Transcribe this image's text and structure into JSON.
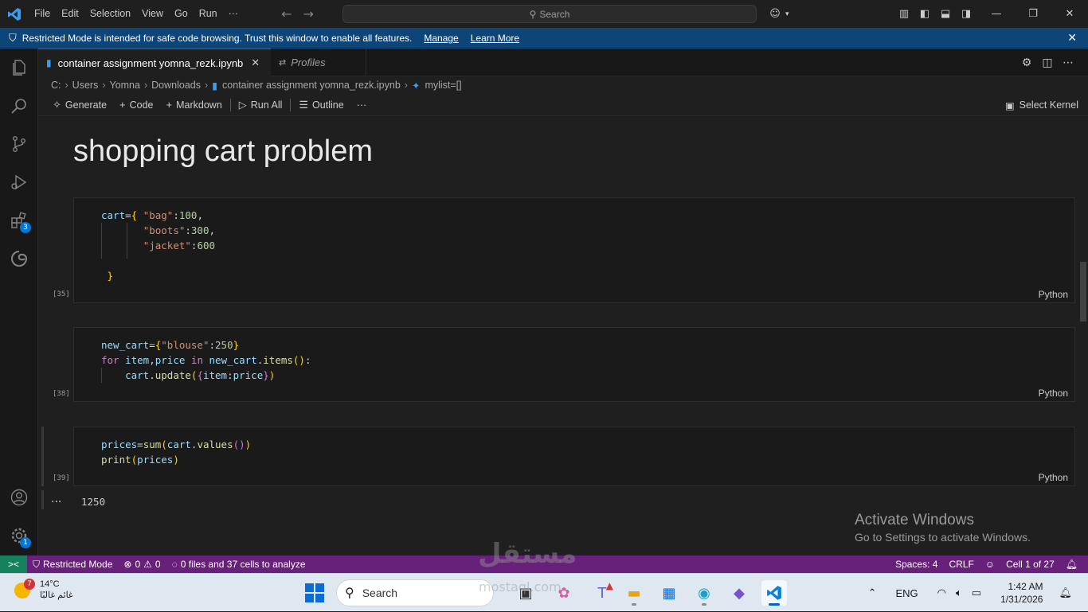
{
  "titlebar": {
    "menus": [
      "File",
      "Edit",
      "Selection",
      "View",
      "Go",
      "Run",
      "···"
    ],
    "search_placeholder": "Search"
  },
  "banner": {
    "message": "Restricted Mode is intended for safe code browsing. Trust this window to enable all features.",
    "manage": "Manage",
    "learn_more": "Learn More"
  },
  "activitybar": {
    "extensions_badge": "3",
    "settings_badge": "1"
  },
  "tabs": [
    {
      "label": "container assignment yomna_rezk.ipynb",
      "active": true
    },
    {
      "label": "Profiles",
      "active": false
    }
  ],
  "breadcrumb": [
    "C:",
    "Users",
    "Yomna",
    "Downloads",
    "container assignment yomna_rezk.ipynb",
    "mylist=[]"
  ],
  "nbtoolbar": {
    "generate": "Generate",
    "code": "Code",
    "markdown": "Markdown",
    "run_all": "Run All",
    "outline": "Outline",
    "more": "···",
    "select_kernel": "Select Kernel"
  },
  "notebook": {
    "heading": "shopping cart problem",
    "cells": [
      {
        "exec": "[35]",
        "lang": "Python"
      },
      {
        "exec": "[38]",
        "lang": "Python"
      },
      {
        "exec": "[39]",
        "lang": "Python"
      }
    ],
    "output": "1250",
    "output_dots": "···"
  },
  "activate": {
    "line1": "Activate Windows",
    "line2": "Go to Settings to activate Windows."
  },
  "statusbar": {
    "remote": "><",
    "restricted": "Restricted Mode",
    "errors": "0",
    "warnings": "0",
    "analyze": "0 files and 37 cells to analyze",
    "spaces": "Spaces: 4",
    "eol": "CRLF",
    "cell": "Cell 1 of 27"
  },
  "taskbar": {
    "weather_temp": "14°C",
    "weather_desc": "غائم غالبًا",
    "weather_badge": "7",
    "search": "Search",
    "lang": "ENG",
    "time": "1:42 AM",
    "date": "1/31/2026"
  },
  "watermark": {
    "arabic": "مستقل",
    "latin": "mostaql.com"
  }
}
